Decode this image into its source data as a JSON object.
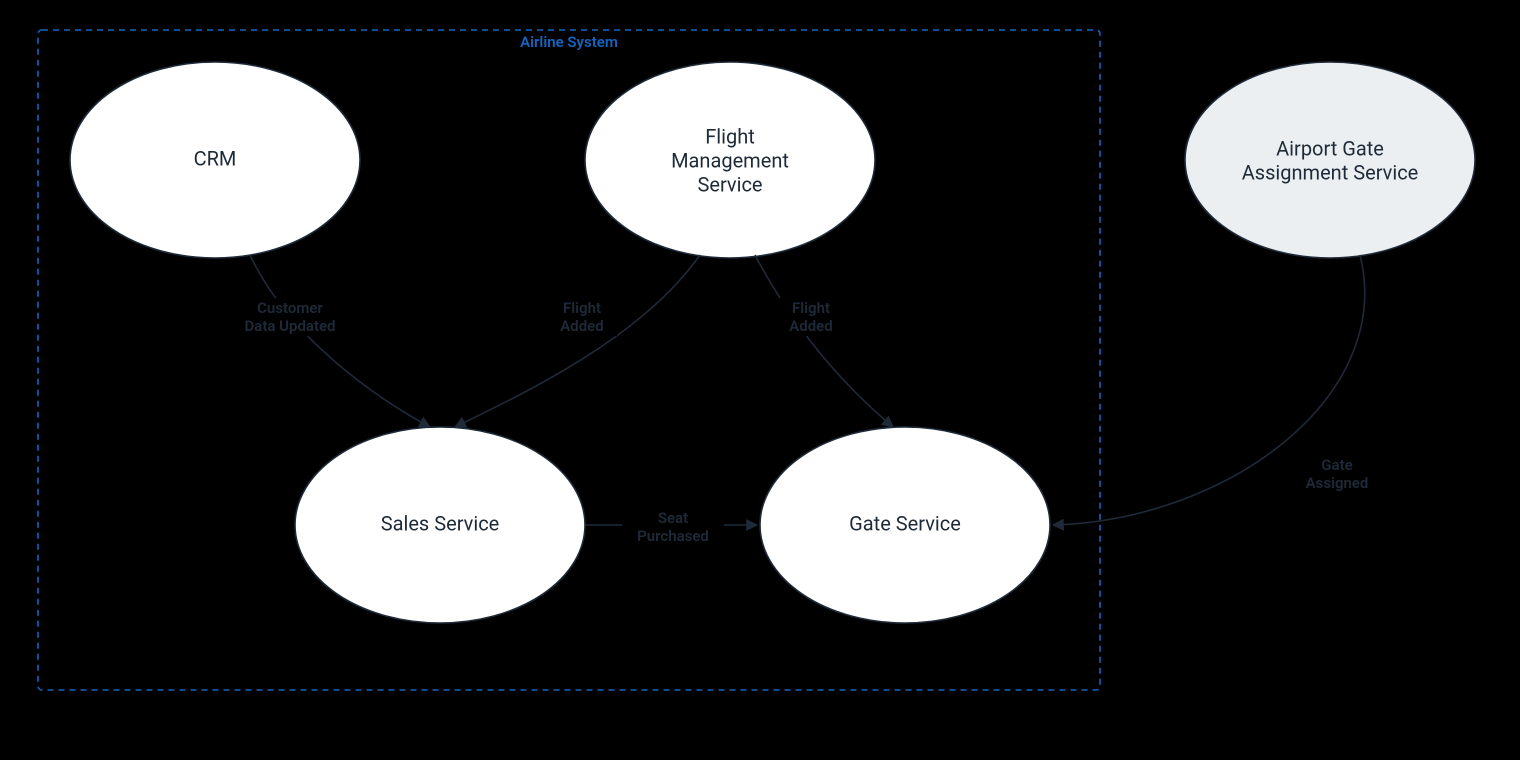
{
  "box": {
    "title": "Airline System"
  },
  "nodes": {
    "crm": {
      "label": "CRM"
    },
    "flight_mgmt": {
      "line1": "Flight",
      "line2": "Management",
      "line3": "Service"
    },
    "sales": {
      "label": "Sales Service"
    },
    "gate": {
      "label": "Gate Service"
    },
    "airport_gate": {
      "line1": "Airport Gate",
      "line2": "Assignment Service"
    }
  },
  "edges": {
    "crm_sales": {
      "line1": "Customer",
      "line2": "Data Updated"
    },
    "fm_sales": {
      "line1": "Flight",
      "line2": "Added"
    },
    "fm_gate": {
      "line1": "Flight",
      "line2": "Added"
    },
    "sales_gate": {
      "line1": "Seat",
      "line2": "Purchased"
    },
    "airport_gate_edge": {
      "line1": "Gate",
      "line2": "Assigned"
    }
  }
}
